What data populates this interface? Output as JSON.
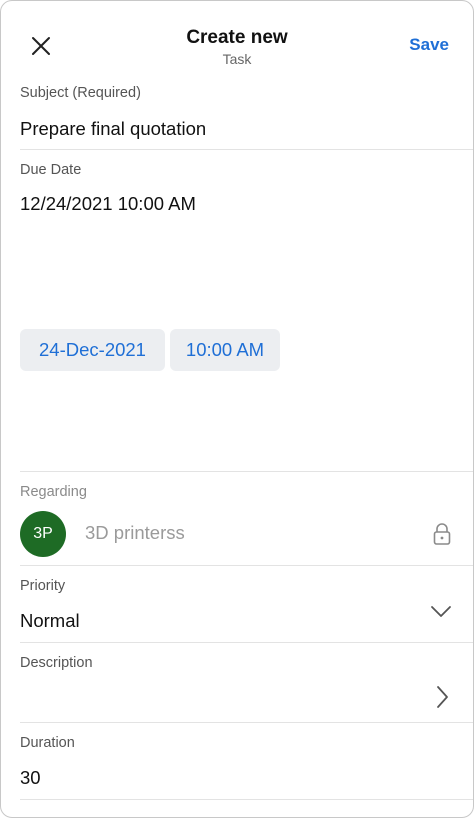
{
  "header": {
    "title": "Create new",
    "subtitle": "Task",
    "save_label": "Save",
    "close_icon": "close-icon"
  },
  "fields": {
    "subject": {
      "label": "Subject (Required)",
      "value": "Prepare final quotation"
    },
    "due_date": {
      "label": "Due Date",
      "value": "12/24/2021 10:00 AM",
      "date_chip": "24-Dec-2021",
      "time_chip": "10:00 AM"
    },
    "regarding": {
      "label": "Regarding",
      "avatar_initials": "3P",
      "avatar_color": "#1e6b25",
      "value": "3D printerss",
      "lock_icon": "lock-icon"
    },
    "priority": {
      "label": "Priority",
      "value": "Normal",
      "icon": "chevron-down-icon"
    },
    "description": {
      "label": "Description",
      "icon": "chevron-right-icon"
    },
    "duration": {
      "label": "Duration",
      "value": "30"
    }
  },
  "colors": {
    "accent": "#1f6fd6",
    "chip_background": "#eceef1"
  }
}
